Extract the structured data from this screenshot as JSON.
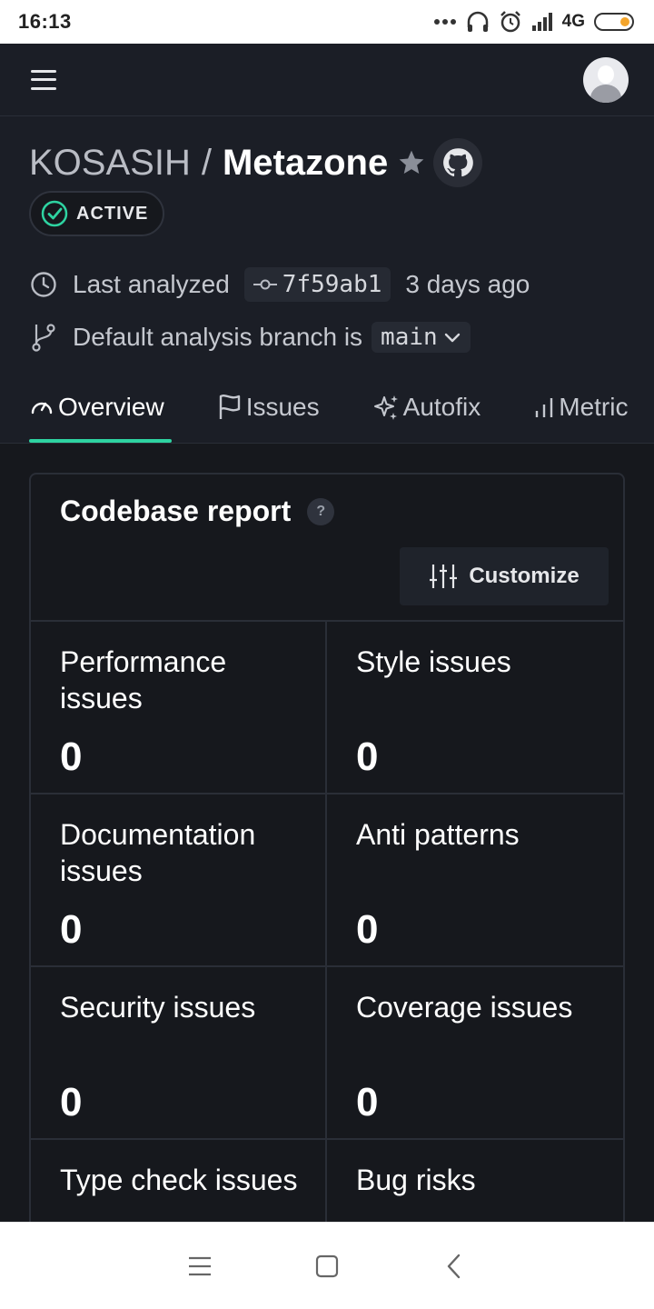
{
  "status_bar": {
    "time": "16:13",
    "network": "4G"
  },
  "header": {
    "owner": "KOSASIH",
    "separator": "/",
    "repo": "Metazone",
    "status_badge": "ACTIVE"
  },
  "analysis": {
    "last_analyzed_label": "Last analyzed",
    "commit": "7f59ab1",
    "time_ago": "3 days ago",
    "branch_label": "Default analysis branch is",
    "branch": "main"
  },
  "tabs": [
    {
      "label": "Overview",
      "icon": "gauge-icon",
      "active": true
    },
    {
      "label": "Issues",
      "icon": "flag-icon",
      "active": false
    },
    {
      "label": "Autofix",
      "icon": "sparkle-icon",
      "active": false
    },
    {
      "label": "Metric",
      "icon": "bar-chart-icon",
      "active": false
    }
  ],
  "report": {
    "title": "Codebase report",
    "help": "?",
    "customize_label": "Customize",
    "metrics": [
      {
        "label": "Performance issues",
        "value": "0"
      },
      {
        "label": "Style issues",
        "value": "0"
      },
      {
        "label": "Documentation issues",
        "value": "0"
      },
      {
        "label": "Anti patterns",
        "value": "0"
      },
      {
        "label": "Security issues",
        "value": "0"
      },
      {
        "label": "Coverage issues",
        "value": "0"
      },
      {
        "label": "Type check issues",
        "value": ""
      },
      {
        "label": "Bug risks",
        "value": ""
      }
    ]
  },
  "colors": {
    "accent": "#2ed3a1",
    "background": "#16181d",
    "header_bg": "#1b1e26"
  }
}
